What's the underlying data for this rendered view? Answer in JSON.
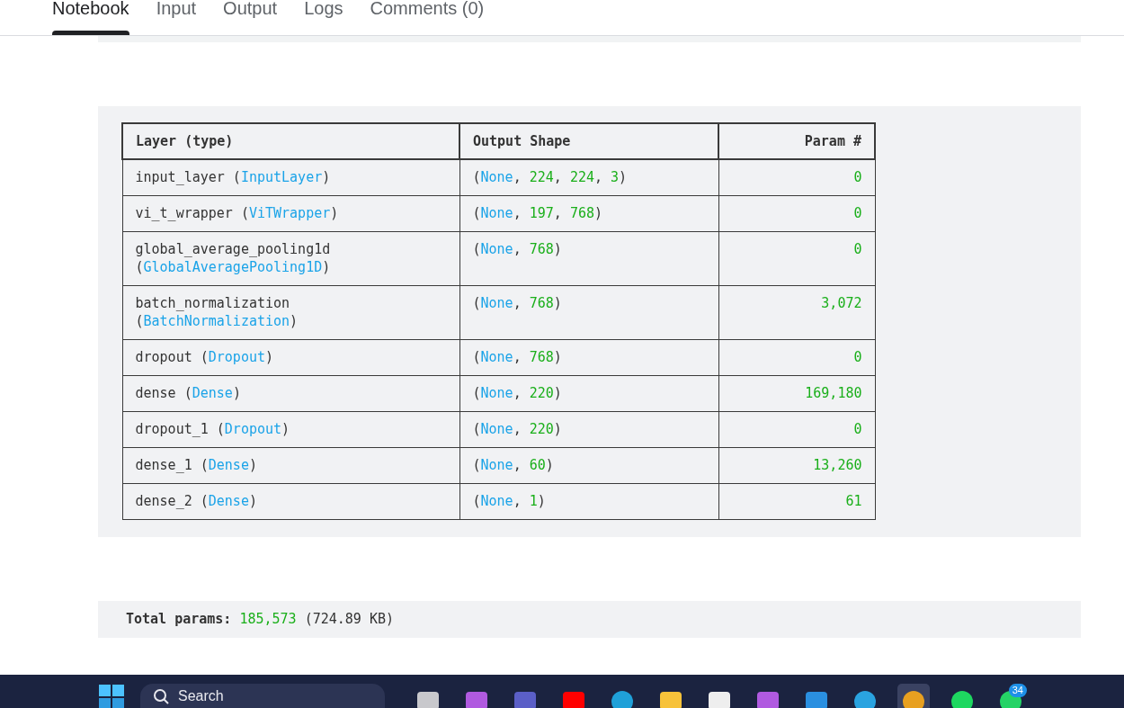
{
  "tabs": [
    {
      "label": "Notebook",
      "selected": true
    },
    {
      "label": "Input",
      "selected": false
    },
    {
      "label": "Output",
      "selected": false
    },
    {
      "label": "Logs",
      "selected": false
    },
    {
      "label": "Comments (0)",
      "selected": false
    }
  ],
  "summary_table": {
    "columns": [
      "Layer (type)",
      "Output Shape",
      "Param #"
    ],
    "rows": [
      {
        "layer": [
          {
            "text": "input_layer (",
            "kind": "plain"
          },
          {
            "text": "InputLayer",
            "kind": "type"
          },
          {
            "text": ")",
            "kind": "plain"
          }
        ],
        "shape": [
          {
            "text": "(",
            "kind": "plain"
          },
          {
            "text": "None",
            "kind": "type"
          },
          {
            "text": ", ",
            "kind": "plain"
          },
          {
            "text": "224",
            "kind": "number"
          },
          {
            "text": ", ",
            "kind": "plain"
          },
          {
            "text": "224",
            "kind": "number"
          },
          {
            "text": ", ",
            "kind": "plain"
          },
          {
            "text": "3",
            "kind": "number"
          },
          {
            "text": ")",
            "kind": "plain"
          }
        ],
        "params": "0"
      },
      {
        "layer": [
          {
            "text": "vi_t_wrapper (",
            "kind": "plain"
          },
          {
            "text": "ViTWrapper",
            "kind": "type"
          },
          {
            "text": ")",
            "kind": "plain"
          }
        ],
        "shape": [
          {
            "text": "(",
            "kind": "plain"
          },
          {
            "text": "None",
            "kind": "type"
          },
          {
            "text": ", ",
            "kind": "plain"
          },
          {
            "text": "197",
            "kind": "number"
          },
          {
            "text": ", ",
            "kind": "plain"
          },
          {
            "text": "768",
            "kind": "number"
          },
          {
            "text": ")",
            "kind": "plain"
          }
        ],
        "params": "0"
      },
      {
        "layer": [
          {
            "text": "global_average_pooling1d\n(",
            "kind": "plain"
          },
          {
            "text": "GlobalAveragePooling1D",
            "kind": "type"
          },
          {
            "text": ")",
            "kind": "plain"
          }
        ],
        "shape": [
          {
            "text": "(",
            "kind": "plain"
          },
          {
            "text": "None",
            "kind": "type"
          },
          {
            "text": ", ",
            "kind": "plain"
          },
          {
            "text": "768",
            "kind": "number"
          },
          {
            "text": ")",
            "kind": "plain"
          }
        ],
        "params": "0"
      },
      {
        "layer": [
          {
            "text": "batch_normalization\n(",
            "kind": "plain"
          },
          {
            "text": "BatchNormalization",
            "kind": "type"
          },
          {
            "text": ")",
            "kind": "plain"
          }
        ],
        "shape": [
          {
            "text": "(",
            "kind": "plain"
          },
          {
            "text": "None",
            "kind": "type"
          },
          {
            "text": ", ",
            "kind": "plain"
          },
          {
            "text": "768",
            "kind": "number"
          },
          {
            "text": ")",
            "kind": "plain"
          }
        ],
        "params": "3,072"
      },
      {
        "layer": [
          {
            "text": "dropout (",
            "kind": "plain"
          },
          {
            "text": "Dropout",
            "kind": "type"
          },
          {
            "text": ")",
            "kind": "plain"
          }
        ],
        "shape": [
          {
            "text": "(",
            "kind": "plain"
          },
          {
            "text": "None",
            "kind": "type"
          },
          {
            "text": ", ",
            "kind": "plain"
          },
          {
            "text": "768",
            "kind": "number"
          },
          {
            "text": ")",
            "kind": "plain"
          }
        ],
        "params": "0"
      },
      {
        "layer": [
          {
            "text": "dense (",
            "kind": "plain"
          },
          {
            "text": "Dense",
            "kind": "type"
          },
          {
            "text": ")",
            "kind": "plain"
          }
        ],
        "shape": [
          {
            "text": "(",
            "kind": "plain"
          },
          {
            "text": "None",
            "kind": "type"
          },
          {
            "text": ", ",
            "kind": "plain"
          },
          {
            "text": "220",
            "kind": "number"
          },
          {
            "text": ")",
            "kind": "plain"
          }
        ],
        "params": "169,180"
      },
      {
        "layer": [
          {
            "text": "dropout_1 (",
            "kind": "plain"
          },
          {
            "text": "Dropout",
            "kind": "type"
          },
          {
            "text": ")",
            "kind": "plain"
          }
        ],
        "shape": [
          {
            "text": "(",
            "kind": "plain"
          },
          {
            "text": "None",
            "kind": "type"
          },
          {
            "text": ", ",
            "kind": "plain"
          },
          {
            "text": "220",
            "kind": "number"
          },
          {
            "text": ")",
            "kind": "plain"
          }
        ],
        "params": "0"
      },
      {
        "layer": [
          {
            "text": "dense_1 (",
            "kind": "plain"
          },
          {
            "text": "Dense",
            "kind": "type"
          },
          {
            "text": ")",
            "kind": "plain"
          }
        ],
        "shape": [
          {
            "text": "(",
            "kind": "plain"
          },
          {
            "text": "None",
            "kind": "type"
          },
          {
            "text": ", ",
            "kind": "plain"
          },
          {
            "text": "60",
            "kind": "number"
          },
          {
            "text": ")",
            "kind": "plain"
          }
        ],
        "params": "13,260"
      },
      {
        "layer": [
          {
            "text": "dense_2 (",
            "kind": "plain"
          },
          {
            "text": "Dense",
            "kind": "type"
          },
          {
            "text": ")",
            "kind": "plain"
          }
        ],
        "shape": [
          {
            "text": "(",
            "kind": "plain"
          },
          {
            "text": "None",
            "kind": "type"
          },
          {
            "text": ", ",
            "kind": "plain"
          },
          {
            "text": "1",
            "kind": "number"
          },
          {
            "text": ")",
            "kind": "plain"
          }
        ],
        "params": "61"
      }
    ]
  },
  "total": {
    "label": "Total params:",
    "value": "185,573",
    "size": "(724.89 KB)"
  },
  "taskbar": {
    "search_placeholder": "Search",
    "apps": [
      {
        "kind": "taskview",
        "active": false
      },
      {
        "kind": "copilot",
        "active": false
      },
      {
        "kind": "teams",
        "active": false
      },
      {
        "kind": "youtube",
        "active": false
      },
      {
        "kind": "edge",
        "active": false
      },
      {
        "kind": "folder",
        "active": false
      },
      {
        "kind": "store",
        "active": false
      },
      {
        "kind": "copilot",
        "active": false
      },
      {
        "kind": "vscode",
        "active": false
      },
      {
        "kind": "telegram",
        "active": false
      },
      {
        "kind": "chrome",
        "active": true
      },
      {
        "kind": "spotify",
        "active": false
      },
      {
        "kind": "whatsapp",
        "active": false,
        "badge": "34"
      }
    ]
  }
}
